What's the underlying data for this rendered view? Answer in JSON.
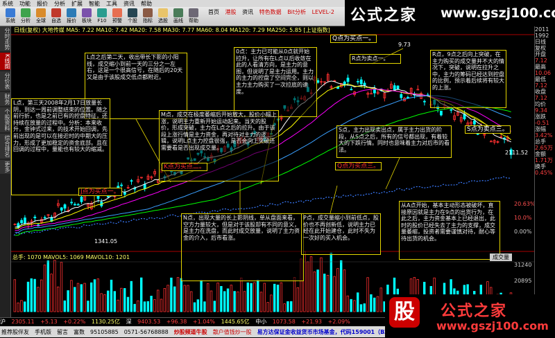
{
  "menubar": {
    "items": [
      "系统",
      "功能",
      "报价",
      "分析",
      "扩展",
      "智能",
      "工具",
      "资讯",
      "帮助"
    ]
  },
  "toolbar": {
    "buttons": [
      {
        "label": "系统",
        "color": "#3a7bd5"
      },
      {
        "label": "分析",
        "color": "#3fa34d"
      },
      {
        "label": "全球",
        "color": "#d98b2b"
      },
      {
        "label": "自选",
        "color": "#c0392b"
      },
      {
        "label": "报价",
        "color": "#2c7bb6"
      },
      {
        "label": "板块",
        "color": "#7b52ab"
      },
      {
        "label": "F10",
        "color": "#2a9d8f"
      },
      {
        "label": "预警",
        "color": "#e76f51"
      },
      {
        "label": "个股",
        "color": "#264653"
      },
      {
        "label": "指标",
        "color": "#8a5a44"
      },
      {
        "label": "选股",
        "color": "#e9c46a"
      },
      {
        "label": "画线",
        "color": "#4a7c59"
      },
      {
        "label": "帮助",
        "color": "#6d6875"
      }
    ],
    "tabs": [
      "首页",
      "港股",
      "资讯",
      "特色数据",
      "Bit分析",
      "LEVEL-2",
      "全球",
      "期货"
    ]
  },
  "brand": {
    "title": "公式之家",
    "url": "www.gszj100.com"
  },
  "sidebar": {
    "tabs": [
      "分时走势",
      "K线图",
      "分价表",
      "财务",
      "个股资料",
      "综合排名",
      "更多"
    ],
    "active": 1
  },
  "chart": {
    "info": "日线(复权) 大地传媒 MA5: 7.22 MA10: 7.42 MA20: 7.58 MA30: 7.77 MA60: 8.04 MA120: 7.29 MA250: 5.85 [上证指数]",
    "price_axis": [
      "9.71",
      "2000",
      "9000",
      "5800",
      "19.09%",
      "5000",
      "4000",
      "3000",
      "2000",
      "1000",
      "0.00%",
      "-2.50%"
    ],
    "max_label": "9.73",
    "min_label": "1341.05",
    "sub_label": "2111.52",
    "vol_info": "总手: 1070 MAVOL5: 1069 MAVOL10: 1201",
    "vol_axis": [
      "31240",
      "20895",
      "10000",
      "0"
    ],
    "vol_select": "成交量",
    "pct_labels": [
      "20.63%",
      "10.0%",
      "0.00%"
    ]
  },
  "annotations": [
    {
      "text": "L点之后第二天，收出带长下影的小阳线，成交缩小到前一天的三分之一左右，这是一个很高信号，在随后的20天又是由于该股成交低点都附近。"
    },
    {
      "text": "L点，第三天2008年2月17日放量长阴，到达一周前调整结束的位置。随之前行折，也是之前已有的控盘特征，还持续在放量的过程中。分析：本来收升，金钟式过来，的技术开始回调，先前出现的是可以在接近时的中期大的压力，形成了更加稳定的资金底部。且在回调的过程中，量能也有较大的缩减。"
    },
    {
      "text": "0点：主力已可能从0点就开始拉升，让所有在L点以后收敛在此的人看清方向，是主力的意图，但说明了是主力运用。主力的主力的控盘了空间完全，则以主力主力购买了一次拉底的速度。"
    },
    {
      "text": "M点，成交在极度萎缩后开始放大，股价小幅上涨，说明主力重新开始运动起来。当天的股价，形成突破，主力在L点之后的拉升。由于该段上涨行情是主力资金，再对待对主力的逻辑，说明L点主力控盘很强，是否会向上突破还需要看是否出现成交量。"
    },
    {
      "text": "R点为卖点一。"
    },
    {
      "text": "R点，9点之后向上突破，在主力购买的成交量并不大的情况下，突破，说明在拉升之中，主力的筹码已经达到控盘的比例，预示着后续将有较大的上涨。"
    },
    {
      "text": "S点，主力出现卖出点，属于主力出货的阶段，从S点之后，所有的信号都出现，有着较大的下跌行情。同时也意味着主力对后市的看法。"
    },
    {
      "text": "N点，出现大量的长上影阴线，单从盘面来看，空方力量较大，但是对于该股却有不同的意义，是主力在洗盘，而此时成交放量，说明了主力资金的介入，后市看涨。"
    },
    {
      "text": "P点，成交量缩小到前低点，股价也不再创新低，说明主力已经在此开始建仓，此时不失为一次好的买入机会。"
    },
    {
      "text": "从A点开始，基本主动形态被破坏，直接原因就是主力在9点的出货行为，在此之后，主力资金基本上已经退出，此时的股价已经失去了主力的支撑，成交量萎缩，投资者需要谨慎对待，耐心等待出货的机会。"
    }
  ],
  "tags": [
    {
      "text": "J点为买点一。",
      "tone": "red"
    },
    {
      "text": "K点为买点二。",
      "tone": "red"
    },
    {
      "text": "Q点为买点一。",
      "tone": "yel"
    },
    {
      "text": "Q点为买点三。",
      "tone": "red"
    },
    {
      "text": "S点为卖点三。",
      "tone": "yel"
    }
  ],
  "right_panel": [
    "2011",
    "1992",
    "日线",
    "复权",
    "开盘",
    "7.12",
    "最高",
    "10.06",
    "最低",
    "7.12",
    "收盘",
    "7.12",
    "均价",
    "9.34",
    "涨跌",
    "-0.51",
    "涨幅",
    "3.42%",
    "总手",
    "2.65万",
    "金额",
    "1.71万",
    "换手",
    "0.45%"
  ],
  "status": {
    "index": [
      {
        "label": "沪",
        "value": "2305.11",
        "chg": "+5.13",
        "pct": "+0.22%",
        "amt": "1130.25亿"
      },
      {
        "label": "深",
        "value": "9403.53",
        "chg": "+96.38",
        "pct": "+1.04%",
        "amt": "1445.65亿"
      },
      {
        "label": "中小",
        "value": "1073.58",
        "chg": "+21.93",
        "pct": "+2.09%",
        "amt": ""
      }
    ],
    "ticker": [
      "推荐股伴友",
      "手机版",
      "留言",
      "富数",
      "95105885",
      "0571-56768888",
      "炒股频道牛股",
      "散户值钱炒一股",
      "易方达保证金收益货币市场基金，代码159001（BZJ）"
    ]
  },
  "logo2": {
    "badge": "股",
    "title": "公式之家",
    "url": "www.gszj100.com"
  },
  "colors": {
    "candle_up": "#ff3030",
    "candle_down": "#00ffff",
    "ma5": "#ffffff",
    "ma10": "#ffff00",
    "ma20": "#ff00ff",
    "ma60": "#00ff00",
    "annotation_border": "#e6d700"
  }
}
